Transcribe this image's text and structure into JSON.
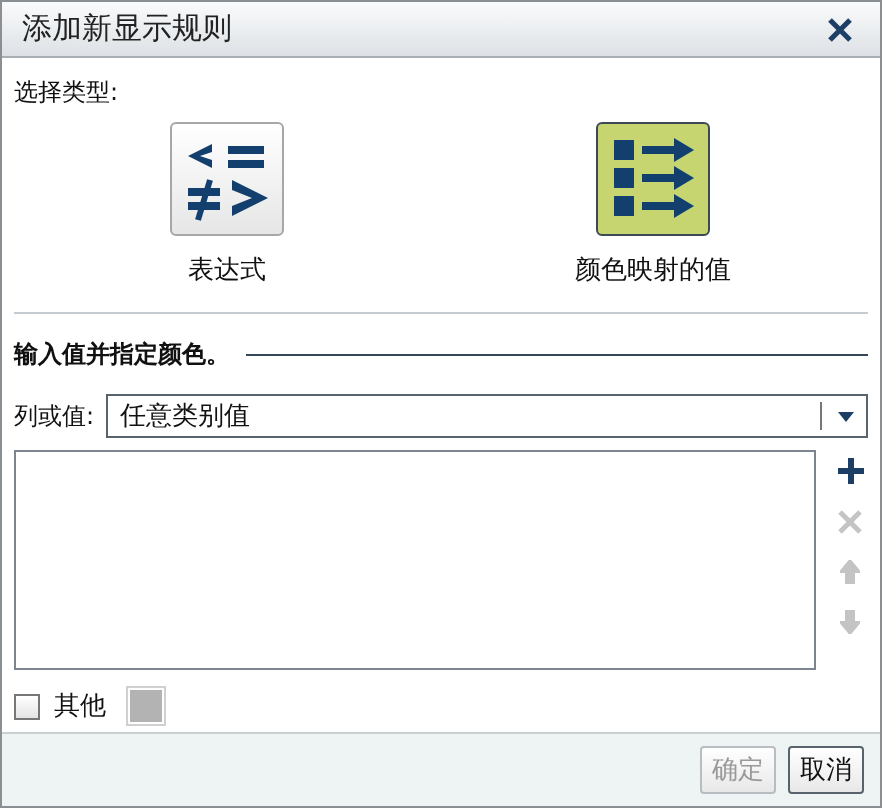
{
  "window": {
    "title": "添加新显示规则"
  },
  "type_section": {
    "label": "选择类型:",
    "options": [
      {
        "kind": "expression",
        "label": "表达式",
        "selected": false
      },
      {
        "kind": "color_map",
        "label": "颜色映射的值",
        "selected": true
      }
    ]
  },
  "values_section": {
    "heading": "输入值并指定颜色。",
    "column_label": "列或值:",
    "column_value": "任意类别值",
    "list_actions": [
      {
        "kind": "add",
        "disabled": false
      },
      {
        "kind": "delete",
        "disabled": true
      },
      {
        "kind": "move_up",
        "disabled": true
      },
      {
        "kind": "move_down",
        "disabled": true
      }
    ],
    "other": {
      "label": "其他",
      "checked": false
    }
  },
  "buttons": [
    {
      "label": "确定",
      "disabled": true
    },
    {
      "label": "取消",
      "disabled": false
    }
  ]
}
